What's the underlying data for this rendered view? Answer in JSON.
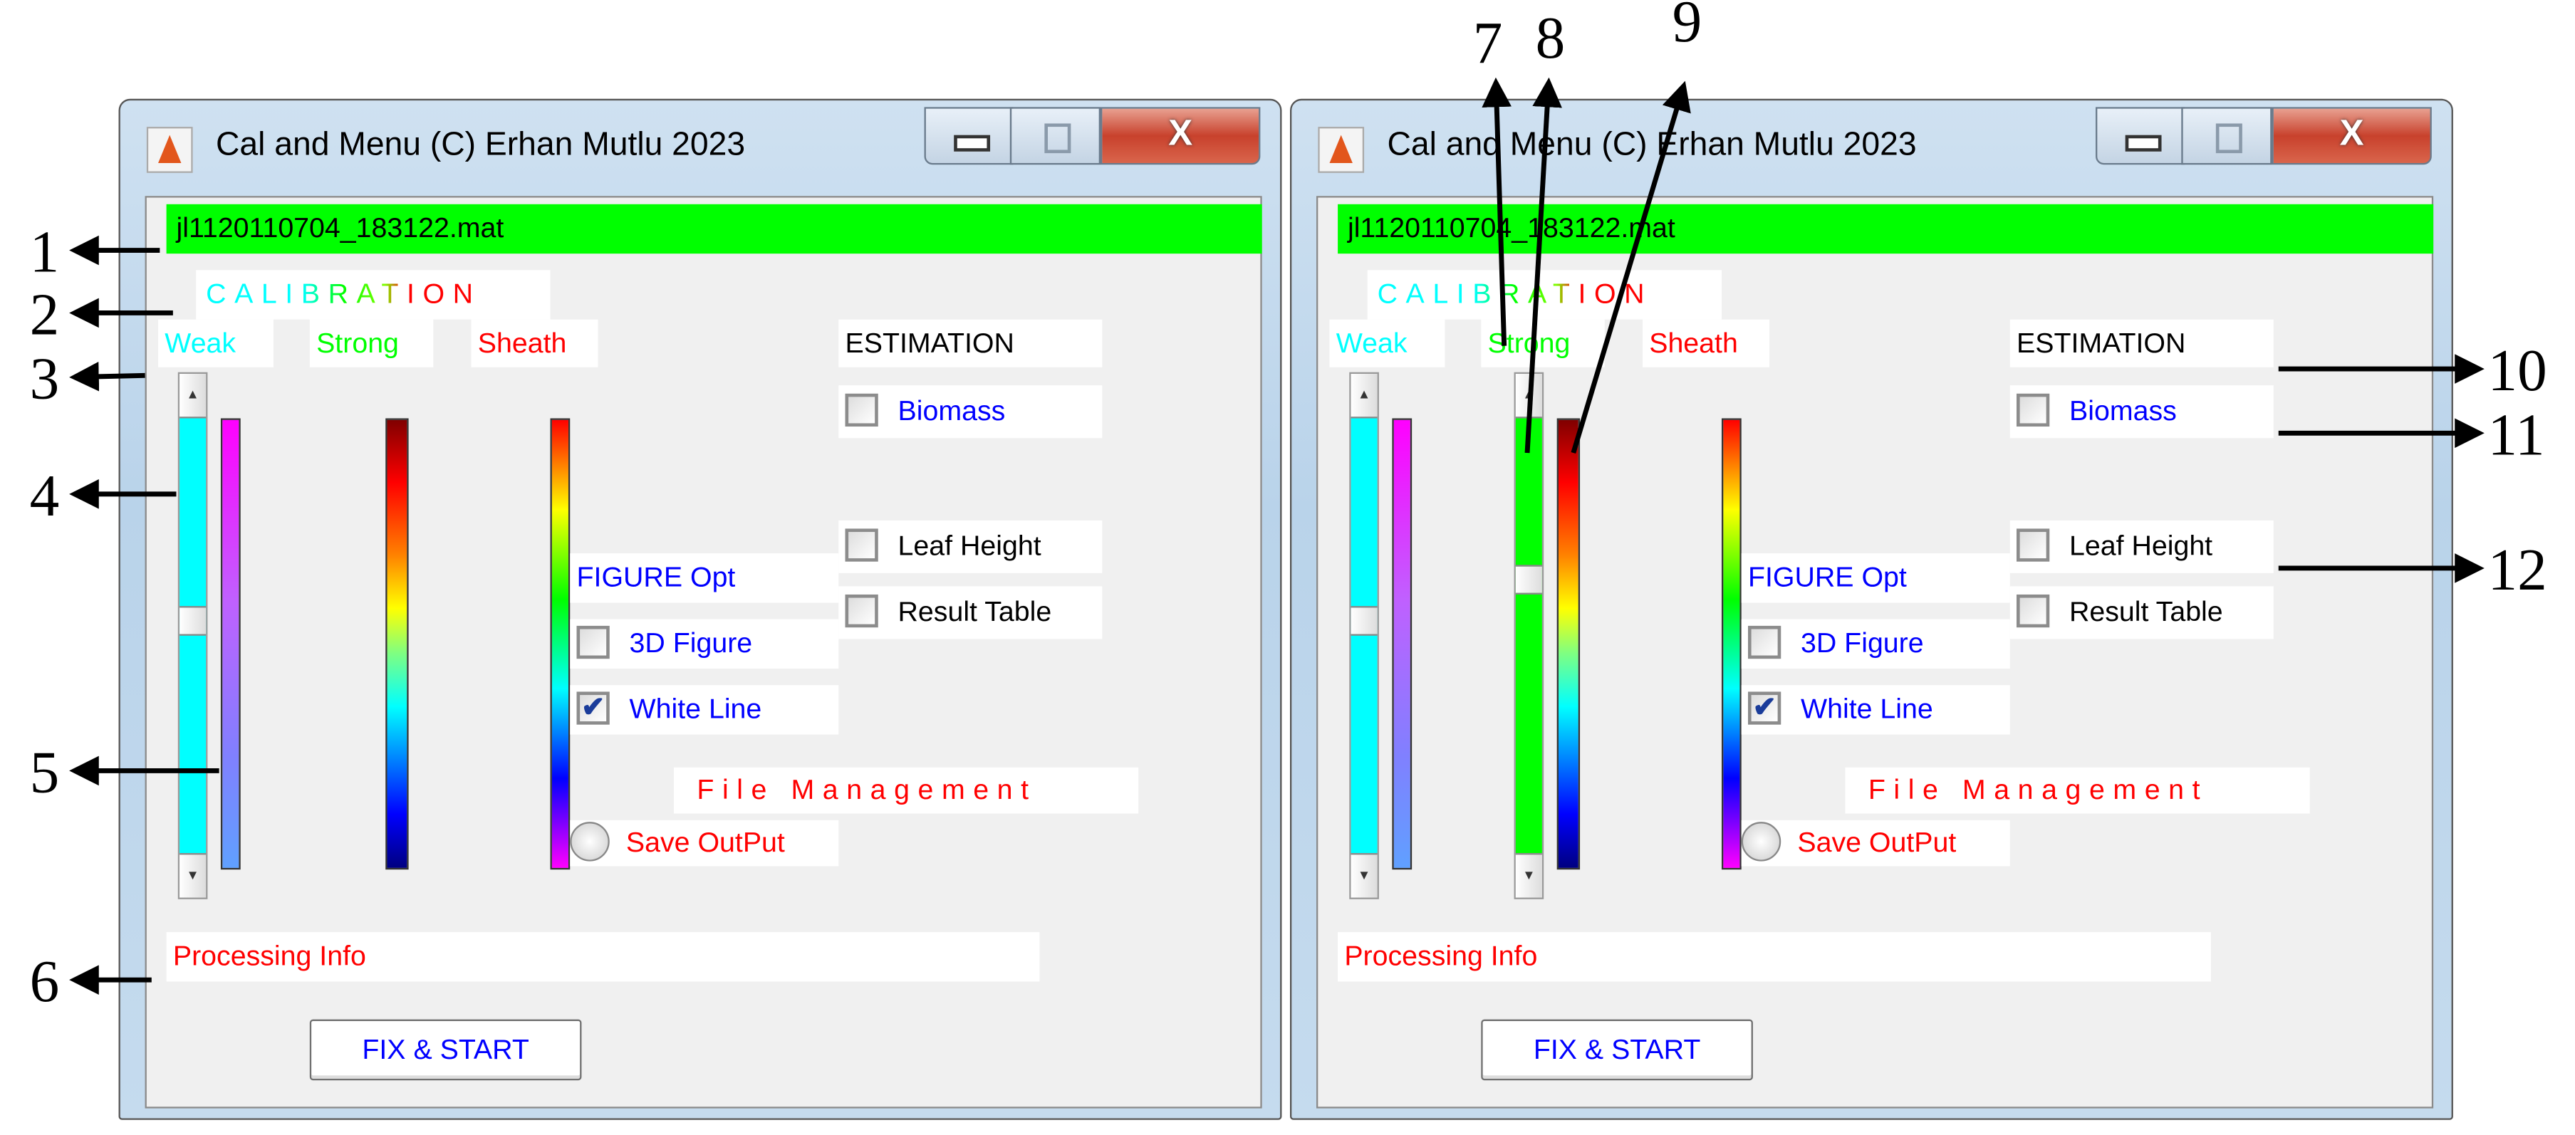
{
  "colors": {
    "accent_green": "#00ff00",
    "cyan": "#00ffff",
    "red": "#ff0000",
    "blue": "#0000ff"
  },
  "windows": [
    {
      "title": "Cal and Menu (C) Erhan Mutlu 2023",
      "close_label": "X",
      "file_name": "jl1120110704_183122.mat",
      "calibration_title": "CALIBRATION",
      "weak_label": "Weak",
      "strong_label": "Strong",
      "sheath_label": "Sheath",
      "estimation_label": "ESTIMATION",
      "biomass": {
        "label": "Biomass",
        "checked": false
      },
      "leaf_height": {
        "label": "Leaf Height",
        "checked": false
      },
      "result_table": {
        "label": "Result Table",
        "checked": false
      },
      "figure_opt_label": "FIGURE Opt",
      "figure_3d": {
        "label": "3D Figure",
        "checked": false
      },
      "white_line": {
        "label": "White Line",
        "checked": true,
        "mark": "✔"
      },
      "file_management_label": "File Management",
      "save_output": {
        "label": "Save OutPut",
        "selected": false
      },
      "processing_info": "Processing Info",
      "fix_start_label": "FIX & START",
      "weak_slider_value": 0.46,
      "strong_slider_visible": false,
      "strong_slider_value": null
    },
    {
      "title": "Cal and Menu (C) Erhan Mutlu 2023",
      "close_label": "X",
      "file_name": "jl1120110704_183122.mat",
      "calibration_title": "CALIBRATION",
      "weak_label": "Weak",
      "strong_label": "Strong",
      "sheath_label": "Sheath",
      "estimation_label": "ESTIMATION",
      "biomass": {
        "label": "Biomass",
        "checked": false
      },
      "leaf_height": {
        "label": "Leaf Height",
        "checked": false
      },
      "result_table": {
        "label": "Result Table",
        "checked": false
      },
      "figure_opt_label": "FIGURE Opt",
      "figure_3d": {
        "label": "3D Figure",
        "checked": false
      },
      "white_line": {
        "label": "White Line",
        "checked": true,
        "mark": "✔"
      },
      "file_management_label": "File Management",
      "save_output": {
        "label": "Save OutPut",
        "selected": false
      },
      "processing_info": "Processing Info",
      "fix_start_label": "FIX & START",
      "weak_slider_value": 0.46,
      "strong_slider_visible": true,
      "strong_slider_value": 0.36
    }
  ],
  "annotations": [
    "1",
    "2",
    "3",
    "4",
    "5",
    "6",
    "7",
    "8",
    "9",
    "10",
    "11",
    "12"
  ]
}
